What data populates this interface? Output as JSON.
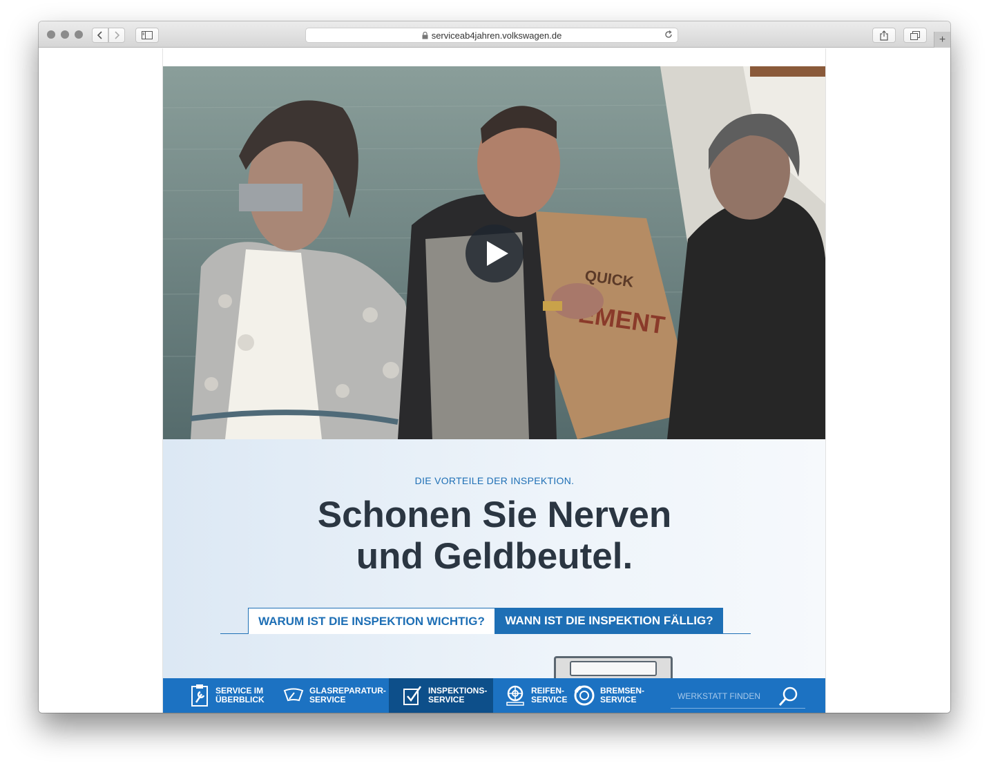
{
  "browser": {
    "url": "serviceab4jahren.volkswagen.de"
  },
  "hero": {
    "eyebrow": "DIE VORTEILE DER INSPEKTION.",
    "headline_line1": "Schonen Sie Nerven",
    "headline_line2": "und Geldbeutel."
  },
  "tabs": [
    {
      "label": "WARUM IST DIE INSPEKTION WICHTIG?",
      "selected": true
    },
    {
      "label": "WANN IST DIE INSPEKTION FÄLLIG?",
      "selected": false
    }
  ],
  "nav": {
    "items": [
      {
        "line1": "SERVICE IM",
        "line2": "ÜBERBLICK",
        "icon": "wrench-clipboard-icon"
      },
      {
        "line1": "GLASREPARATUR-",
        "line2": "SERVICE",
        "icon": "windshield-icon"
      },
      {
        "line1": "INSPEKTIONS-",
        "line2": "SERVICE",
        "icon": "checklist-icon",
        "active": true
      },
      {
        "line1": "REIFEN-",
        "line2": "SERVICE",
        "icon": "tire-icon"
      },
      {
        "line1": "BREMSEN-",
        "line2": "SERVICE",
        "icon": "brake-disc-icon"
      }
    ],
    "search_placeholder": "WERKSTATT FINDEN"
  },
  "colors": {
    "brand_blue": "#1c72c2",
    "active_blue": "#0d4f8a",
    "headline": "#2b3642",
    "accent_text": "#1e6fb5"
  }
}
